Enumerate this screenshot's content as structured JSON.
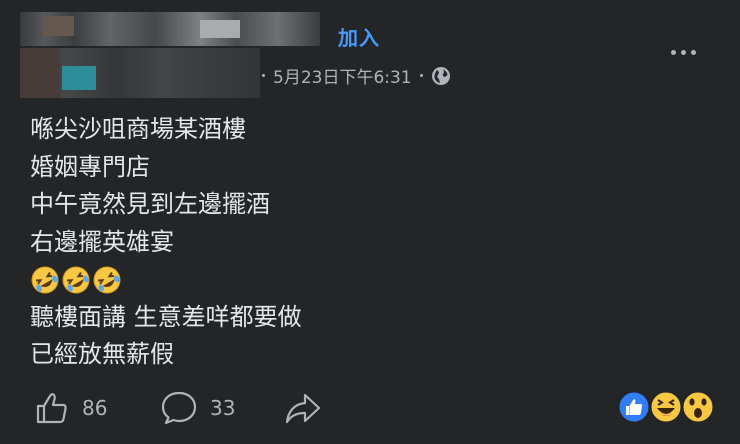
{
  "header": {
    "join_label": "加入",
    "timestamp": "5月23日下午6:31",
    "more_icon": "more-horizontal-icon",
    "privacy_icon": "globe-icon"
  },
  "post": {
    "lines": [
      "喺尖沙咀商場某酒樓",
      "婚姻專門店",
      "中午竟然見到左邊擺酒",
      "右邊擺英雄宴",
      "聽樓面講 生意差咩都要做",
      "已經放無薪假"
    ],
    "emoji_line": [
      "rolling-laughing-emoji",
      "rolling-laughing-emoji",
      "rolling-laughing-emoji"
    ]
  },
  "footer": {
    "likes": "86",
    "comments": "33",
    "like_icon": "thumbs-up-icon",
    "comment_icon": "comment-icon",
    "share_icon": "share-icon",
    "reactions": [
      "like-reaction-icon",
      "haha-reaction-icon",
      "wow-reaction-icon"
    ]
  },
  "colors": {
    "background": "#242526",
    "text": "#e4e6eb",
    "secondary": "#b0b3b8",
    "link": "#4599ff"
  }
}
